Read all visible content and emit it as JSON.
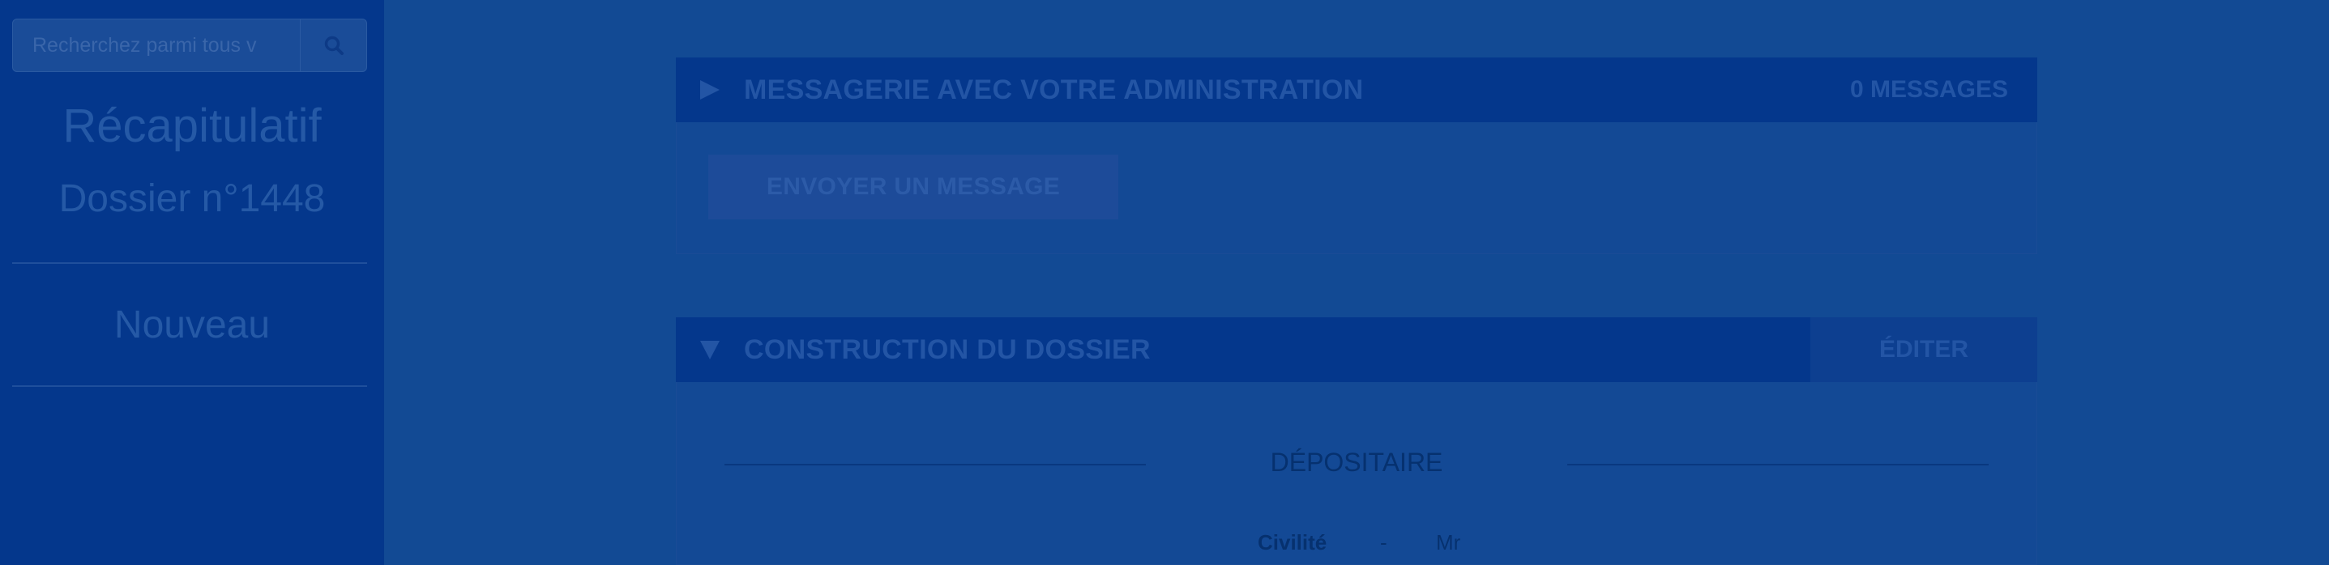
{
  "sidebar": {
    "search_placeholder": "Recherchez parmi tous v",
    "title": "Récapitulatif",
    "dossier": "Dossier n°1448",
    "status": "Nouveau"
  },
  "messagerie": {
    "title": "MESSAGERIE AVEC VOTRE ADMINISTRATION",
    "count": "0 MESSAGES",
    "send_button": "ENVOYER UN MESSAGE"
  },
  "construction": {
    "title": "CONSTRUCTION DU DOSSIER",
    "edit_button": "ÉDITER",
    "section_title": "DÉPOSITAIRE",
    "fields": [
      {
        "label": "Civilité",
        "separator": "-",
        "value": "Mr"
      }
    ]
  },
  "icons": {
    "search": "search-icon",
    "collapsed": "triangle-right-icon",
    "expanded": "triangle-down-icon"
  },
  "colors": {
    "overlay_bg": "#124a94",
    "sidebar_bg": "#04378c",
    "panel_header_bg": "#04378c"
  }
}
